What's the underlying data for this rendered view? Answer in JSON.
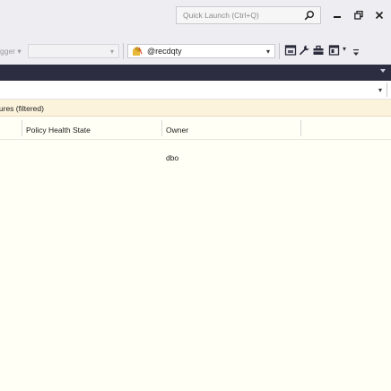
{
  "titlebar": {
    "quick_launch_placeholder": "Quick Launch (Ctrl+Q)"
  },
  "toolbar": {
    "debugger_label": "gger",
    "database_selected": "@recdqty"
  },
  "infobar": {
    "text": "lures (filtered)"
  },
  "table": {
    "columns": [
      "Policy Health State",
      "Owner"
    ],
    "rows": [
      {
        "policy_health_state": "",
        "owner": "dbo"
      }
    ]
  },
  "colors": {
    "accent_dark": "#2d2d42",
    "info_bar": "#fcf3dd",
    "grid_background": "#fffff5"
  }
}
